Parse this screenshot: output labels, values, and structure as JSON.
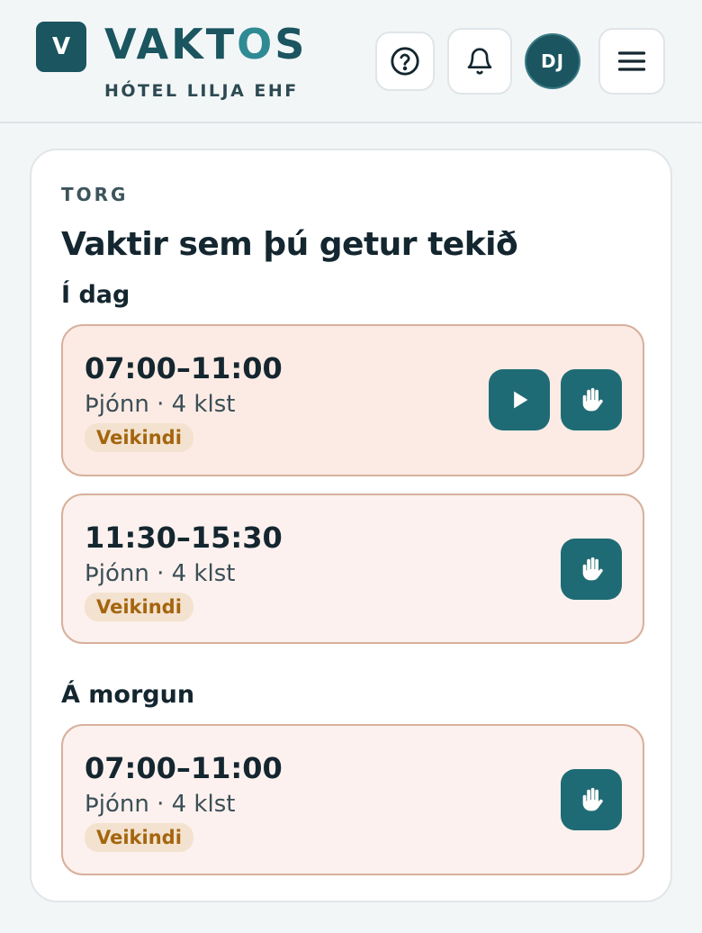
{
  "header": {
    "logo_letter": "V",
    "brand_prefix": "VAKT",
    "brand_accent": "O",
    "brand_suffix": "S",
    "company": "HÓTEL LILJA EHF",
    "help_icon": "question-circle-icon",
    "bell_icon": "bell-icon",
    "avatar_initials": "DJ",
    "menu_icon": "hamburger-menu-icon"
  },
  "main": {
    "eyebrow": "TORG",
    "title": "Vaktir sem þú getur tekið",
    "sections": [
      {
        "label": "Í dag",
        "shifts": [
          {
            "time": "07:00–11:00",
            "meta": "Þjónn · 4 klst",
            "tag": "Veikindi",
            "actions": [
              "play-icon",
              "raise-hand-icon"
            ]
          },
          {
            "time": "11:30–15:30",
            "meta": "Þjónn · 4 klst",
            "tag": "Veikindi",
            "actions": [
              "raise-hand-icon"
            ]
          }
        ]
      },
      {
        "label": "Á morgun",
        "shifts": [
          {
            "time": "07:00–11:00",
            "meta": "Þjónn · 4 klst",
            "tag": "Veikindi",
            "actions": [
              "raise-hand-icon"
            ]
          }
        ]
      }
    ]
  },
  "colors": {
    "brand": "#1a5560",
    "brand_accent": "#2f8a94",
    "action_button": "#1f6b75",
    "shift_card_bg": "#fcf1ee",
    "shift_card_border": "#d7b09c",
    "tag_bg": "#f3e2cf",
    "tag_text": "#a4650e"
  }
}
